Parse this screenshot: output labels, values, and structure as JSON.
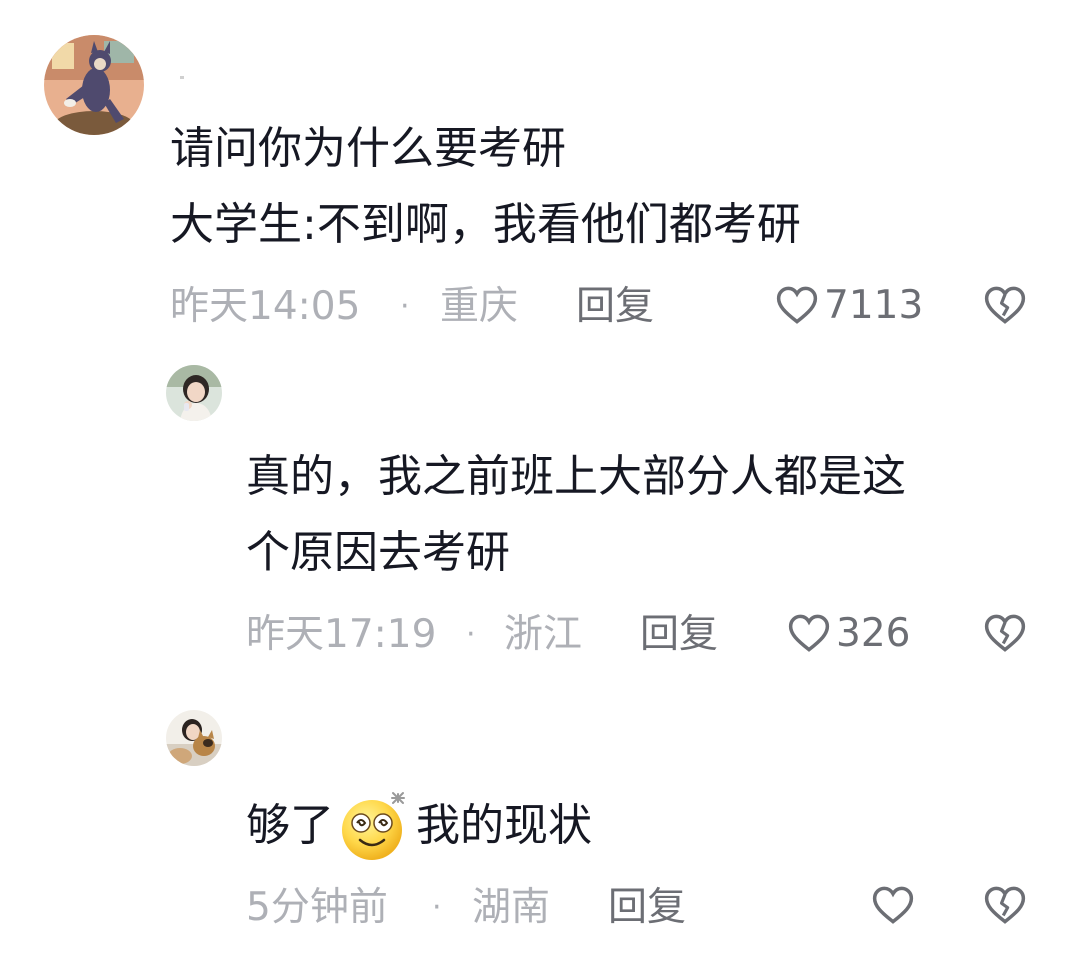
{
  "comments": [
    {
      "lines": [
        "请问你为什么要考研",
        "大学生:不到啊，我看他们都考研"
      ],
      "time": "昨天14:05",
      "location": "重庆",
      "reply_label": "回复",
      "likes": "7113",
      "avatar_icon": "cartoon-cat-avatar"
    },
    {
      "lines": [
        "真的，我之前班上大部分人都是这",
        "个原因去考研"
      ],
      "time": "昨天17:19",
      "location": "浙江",
      "reply_label": "回复",
      "likes": "326",
      "avatar_icon": "girl-photo-avatar"
    },
    {
      "text_before": "够了",
      "emoji": "dizzy-smile-emoji",
      "text_after": "我的现状",
      "time": "5分钟前",
      "location": "湖南",
      "reply_label": "回复",
      "likes": "",
      "avatar_icon": "girl-with-dog-avatar"
    }
  ],
  "colors": {
    "text": "#161823",
    "meta": "#aeb0b6",
    "action": "#6c6e74"
  }
}
